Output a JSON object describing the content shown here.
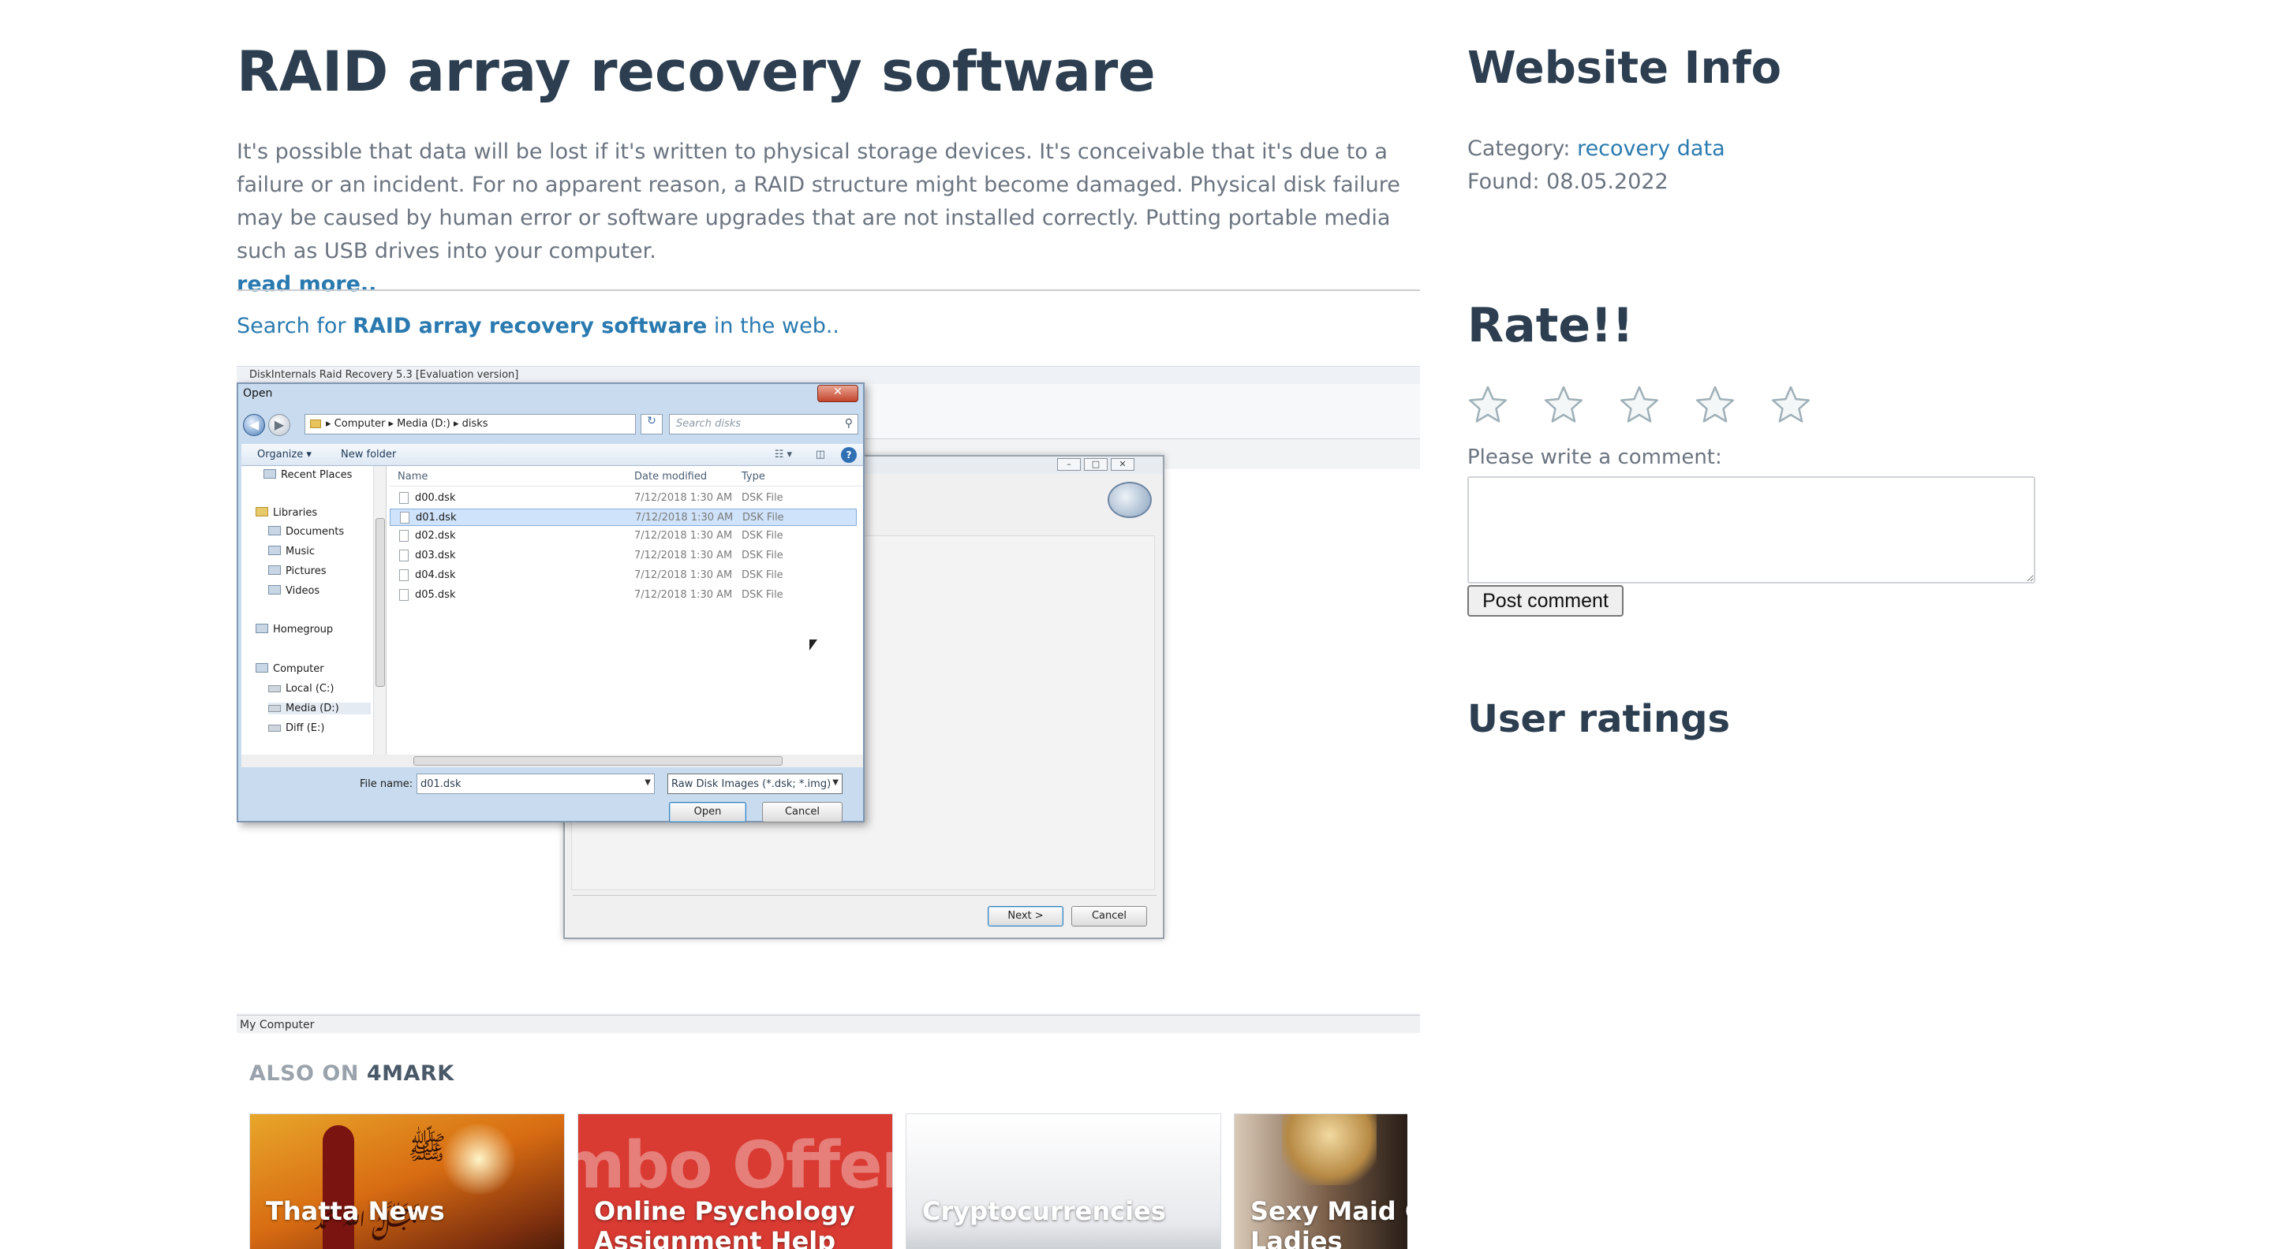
{
  "article": {
    "title": "RAID array recovery software",
    "description": "It's possible that data will be lost if it's written to physical storage devices. It's conceivable that it's due to a failure or an incident. For no apparent reason, a RAID structure might become damaged. Physical disk failure may be caused by human error or software upgrades that are not installed correctly. Putting portable media such as USB drives into your computer.",
    "read_more": "read more..",
    "search_prefix": "Search for ",
    "search_term": "RAID array recovery software",
    "search_suffix": " in the web.."
  },
  "screenshot": {
    "app_title": "DiskInternals Raid Recovery 5.3 [Evaluation version]",
    "status_bar": "My Computer",
    "open_dialog": {
      "title": "Open",
      "breadcrumb": [
        "Computer",
        "Media (D:)",
        "disks"
      ],
      "search_placeholder": "Search disks",
      "toolbar": {
        "organize": "Organize ▾",
        "new_folder": "New folder"
      },
      "nav_items": [
        {
          "label": "Recent Places",
          "icon": "recent-places-icon"
        },
        {
          "label": "Libraries",
          "icon": "libraries-icon"
        },
        {
          "label": "Documents",
          "icon": "documents-icon"
        },
        {
          "label": "Music",
          "icon": "music-icon"
        },
        {
          "label": "Pictures",
          "icon": "pictures-icon"
        },
        {
          "label": "Videos",
          "icon": "videos-icon"
        },
        {
          "label": "Homegroup",
          "icon": "homegroup-icon"
        },
        {
          "label": "Computer",
          "icon": "computer-icon"
        },
        {
          "label": "Local (C:)",
          "icon": "drive-icon"
        },
        {
          "label": "Media (D:)",
          "icon": "drive-icon"
        },
        {
          "label": "Diff (E:)",
          "icon": "drive-icon"
        }
      ],
      "columns": {
        "name": "Name",
        "date": "Date modified",
        "type": "Type"
      },
      "files": [
        {
          "name": "d00.dsk",
          "date": "7/12/2018 1:30 AM",
          "type": "DSK File",
          "selected": false
        },
        {
          "name": "d01.dsk",
          "date": "7/12/2018 1:30 AM",
          "type": "DSK File",
          "selected": true
        },
        {
          "name": "d02.dsk",
          "date": "7/12/2018 1:30 AM",
          "type": "DSK File",
          "selected": false
        },
        {
          "name": "d03.dsk",
          "date": "7/12/2018 1:30 AM",
          "type": "DSK File",
          "selected": false
        },
        {
          "name": "d04.dsk",
          "date": "7/12/2018 1:30 AM",
          "type": "DSK File",
          "selected": false
        },
        {
          "name": "d05.dsk",
          "date": "7/12/2018 1:30 AM",
          "type": "DSK File",
          "selected": false
        }
      ],
      "file_name_label": "File name:",
      "file_name_value": "d01.dsk",
      "filter_value": "Raw Disk Images (*.dsk; *.img)",
      "open_button": "Open",
      "cancel_button": "Cancel"
    },
    "wizard": {
      "next_button": "Next >",
      "cancel_button": "Cancel"
    }
  },
  "also_on": {
    "prefix": "ALSO ON ",
    "brand": "4MARK",
    "cards": [
      {
        "title": "Thatta News"
      },
      {
        "title": "Online Psychology Assignment Help",
        "promo_text": "mbo Offer"
      },
      {
        "title": "Cryptocurrencies"
      },
      {
        "title": "Sexy Maid Costume Ladies"
      }
    ]
  },
  "sidebar": {
    "website_info_title": "Website Info",
    "category_label": "Category: ",
    "category_value": "recovery data",
    "found_label": "Found: ",
    "found_value": "08.05.2022",
    "rate_title": "Rate!!",
    "star_count": 5,
    "rating_value": 0,
    "comment_label": "Please write a comment:",
    "comment_value": "",
    "post_button": "Post comment",
    "user_ratings_title": "User ratings"
  },
  "colors": {
    "heading": "#2c3e50",
    "link": "#2a7ab0",
    "body_text": "#6b7480"
  }
}
